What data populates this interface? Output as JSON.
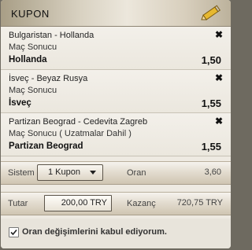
{
  "header": {
    "title": "KUPON",
    "icon": "pencil-icon"
  },
  "bets": [
    {
      "match": "Bulgaristan - Hollanda",
      "market": "Maç Sonucu",
      "selection": "Hollanda",
      "odds": "1,50"
    },
    {
      "match": "İsveç - Beyaz Rusya",
      "market": "Maç Sonucu",
      "selection": "İsveç",
      "odds": "1,55"
    },
    {
      "match": "Partizan Beograd - Cedevita Zagreb",
      "market": "Maç Sonucu ( Uzatmalar Dahil )",
      "selection": "Partizan Beograd",
      "odds": "1,55"
    }
  ],
  "system": {
    "label": "Sistem",
    "selected": "1 Kupon",
    "odds_label": "Oran",
    "odds_value": "3,60"
  },
  "stake": {
    "label": "Tutar",
    "value": "200,00 TRY",
    "win_label": "Kazanç",
    "win_value": "720,75 TRY"
  },
  "accept_changes": {
    "label": "Oran değişimlerini kabul ediyorum.",
    "checked": true
  }
}
